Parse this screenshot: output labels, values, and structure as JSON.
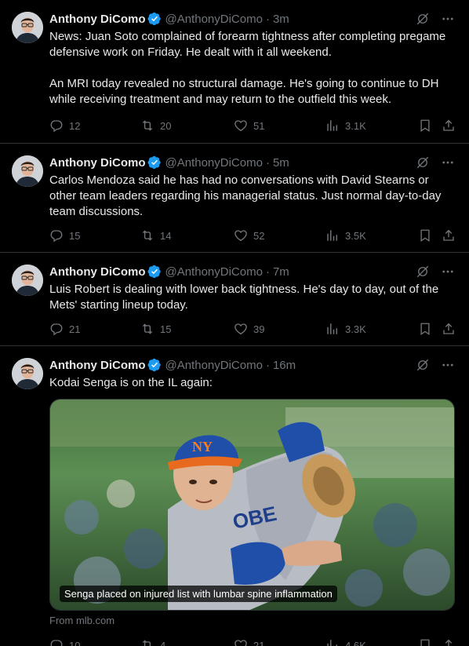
{
  "tweets": [
    {
      "name": "Anthony DiComo",
      "handle": "@AnthonyDiComo",
      "time": "3m",
      "text": "News: Juan Soto complained of forearm tightness after completing pregame defensive work on Friday. He dealt with it all weekend.\n\nAn MRI today revealed no structural damage. He's going to continue to DH while receiving treatment and may return to the outfield this week.",
      "replies": "12",
      "reposts": "20",
      "likes": "51",
      "views": "3.1K"
    },
    {
      "name": "Anthony DiComo",
      "handle": "@AnthonyDiComo",
      "time": "5m",
      "text": "Carlos Mendoza said he has had no conversations with David Stearns or other team leaders regarding his managerial status. Just normal day-to-day team discussions.",
      "replies": "15",
      "reposts": "14",
      "likes": "52",
      "views": "3.5K"
    },
    {
      "name": "Anthony DiComo",
      "handle": "@AnthonyDiComo",
      "time": "7m",
      "text": "Luis Robert is dealing with lower back tightness. He's day to day, out of the Mets' starting lineup today.",
      "replies": "21",
      "reposts": "15",
      "likes": "39",
      "views": "3.3K"
    },
    {
      "name": "Anthony DiComo",
      "handle": "@AnthonyDiComo",
      "time": "16m",
      "text": "Kodai Senga is on the IL again:",
      "card_caption": "Senga placed on injured list with lumbar spine inflammation",
      "card_source": "From mlb.com",
      "replies": "10",
      "reposts": "4",
      "likes": "21",
      "views": "4.6K"
    }
  ],
  "colors": {
    "background": "#000000",
    "text": "#e7e9ea",
    "muted": "#71767b",
    "verified": "#1d9bf0",
    "divider": "#2f3336"
  },
  "icons": [
    "verified-badge-icon",
    "grok-icon",
    "more-icon",
    "reply-icon",
    "repost-icon",
    "like-icon",
    "views-icon",
    "bookmark-icon",
    "share-icon"
  ]
}
